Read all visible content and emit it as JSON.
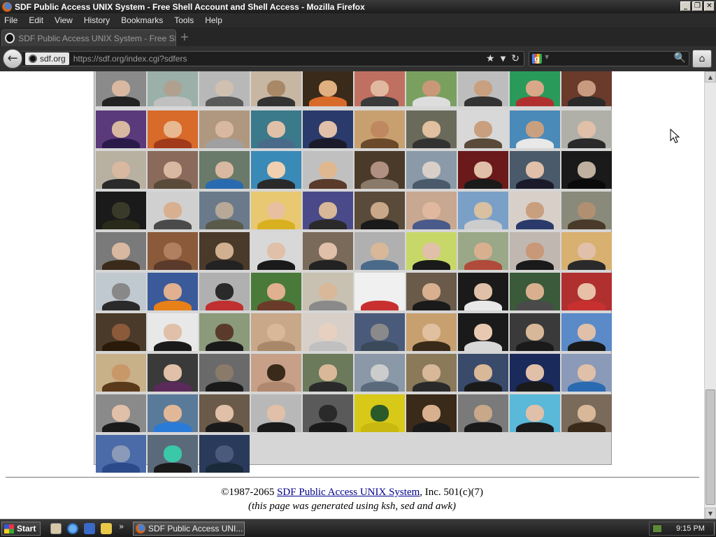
{
  "window": {
    "title": "SDF Public Access UNIX System - Free Shell Account and Shell Access - Mozilla Firefox",
    "controls": {
      "minimize": "_",
      "maximize": "❐",
      "close": "✕"
    }
  },
  "menu": [
    "File",
    "Edit",
    "View",
    "History",
    "Bookmarks",
    "Tools",
    "Help"
  ],
  "tab": {
    "label": "SDF Public Access UNIX System - Free Shell",
    "new_tab": "+"
  },
  "nav": {
    "back": "←",
    "site_chip": "sdf.org",
    "url": "https://sdf.org/index.cgi?sdfers",
    "icons": {
      "star": "★",
      "dropdown": "▼",
      "reload": "↻"
    },
    "search": {
      "engine": "g",
      "dropdown": "▼",
      "go": "🔍"
    },
    "home": "⌂"
  },
  "gallery": {
    "rows": [
      [
        [
          "#8a8a8a",
          "#222",
          "#d8b8a0"
        ],
        [
          "#9ab0a8",
          "#c0c0c0",
          "#b0a090"
        ],
        [
          "#b8b8b8",
          "#5a5a5a",
          "#d0c0b0"
        ],
        [
          "#c6b6a2",
          "#333",
          "#a88866"
        ],
        [
          "#3a2a1a",
          "#d86a2a",
          "#e0b080"
        ],
        [
          "#c07060",
          "#3a3a3a",
          "#e0b8a0"
        ],
        [
          "#7aa060",
          "#ddd",
          "#c89878"
        ],
        [
          "#bdbdbd",
          "#333",
          "#c8a080"
        ],
        [
          "#2a9a5a",
          "#b03030",
          "#d8a888"
        ],
        [
          "#6a3a2a",
          "#2a2a2a",
          "#c89a80"
        ]
      ],
      [
        [
          "#5a3a7a",
          "#2a1a4a",
          "#d8b8a0"
        ],
        [
          "#d86a2a",
          "#a03a1a",
          "#e8b890"
        ],
        [
          "#b09880",
          "#a0a0a0",
          "#d8b8a0"
        ],
        [
          "#3a7a8a",
          "#4a6a8a",
          "#e0c0a8"
        ],
        [
          "#2a3a6a",
          "#1a1a2a",
          "#e0c0a8"
        ],
        [
          "#c8a070",
          "#6a4a2a",
          "#c08860"
        ],
        [
          "#6a6a5a",
          "#333",
          "#e0c0a0"
        ],
        [
          "#d8d8d8",
          "#5a4a3a",
          "#c8a080"
        ],
        [
          "#4a8ab8",
          "#e8e8e8",
          "#c8a080"
        ],
        [
          "#b0b0a8",
          "#2a2a2a",
          "#e0c0a8"
        ]
      ],
      [
        [
          "#b8b0a0",
          "#2a2a2a",
          "#d8b8a0"
        ],
        [
          "#8a6a5a",
          "#5a4a3a",
          "#d8b8a0"
        ],
        [
          "#6a7a6a",
          "#2a6ab0",
          "#d8b8a0"
        ],
        [
          "#3a8ab8",
          "#2a2a2a",
          "#f0d0b0"
        ],
        [
          "#c0c0c0",
          "#5a3a2a",
          "#e0b890"
        ],
        [
          "#4a3a2a",
          "#8a7a6a",
          "#b09080"
        ],
        [
          "#8a9aa8",
          "#4a5a6a",
          "#d8d0c8"
        ],
        [
          "#6a1a1a",
          "#1a1a1a",
          "#e0c0a8"
        ],
        [
          "#4a5a6a",
          "#1a1a2a",
          "#e0c0a8"
        ],
        [
          "#1a1a1a",
          "#0a0a0a",
          "#c0b0a0"
        ]
      ],
      [
        [
          "#1a1a1a",
          "#2a2a1a",
          "#3a3a2a"
        ],
        [
          "#d0d0d0",
          "#4a4a4a",
          "#d8b090"
        ],
        [
          "#6a7a8a",
          "#5a5a4a",
          "#b8a898"
        ],
        [
          "#e8c870",
          "#d8b020",
          "#e8c0a0"
        ],
        [
          "#4a4a8a",
          "#2a2a2a",
          "#d8b898"
        ],
        [
          "#5a4a3a",
          "#1a1a1a",
          "#c8a888"
        ],
        [
          "#c8a890",
          "#4a5a8a",
          "#e0b8a0"
        ],
        [
          "#7aa0c8",
          "#ccc",
          "#d8c0a0"
        ],
        [
          "#d8d0c8",
          "#2a3a6a",
          "#c8a080"
        ],
        [
          "#8a8a7a",
          "#4a3a2a",
          "#b09070"
        ]
      ],
      [
        [
          "#7a7a7a",
          "#3a2a1a",
          "#d8b8a0"
        ],
        [
          "#8a5a3a",
          "#5a3a2a",
          "#b08060"
        ],
        [
          "#4a3a2a",
          "#222",
          "#d0b090"
        ],
        [
          "#d8d8d8",
          "#1a1a1a",
          "#e0c0a8"
        ],
        [
          "#7a6a5a",
          "#222",
          "#e0c0a8"
        ],
        [
          "#b0b0b0",
          "#4a6a8a",
          "#d8b898"
        ],
        [
          "#c8d868",
          "#1a1a1a",
          "#e0c0a8"
        ],
        [
          "#9aa888",
          "#b04a3a",
          "#d8b090"
        ],
        [
          "#c0b8b0",
          "#1a1a1a",
          "#c89878"
        ],
        [
          "#d8b070",
          "#2a2a2a",
          "#e0c0a8"
        ]
      ],
      [
        [
          "#c0c8d0",
          "#2a2a2a",
          "#888888"
        ],
        [
          "#3a5a9a",
          "#e8801a",
          "#e0b090"
        ],
        [
          "#b0b0b0",
          "#c03030",
          "#2a2a2a"
        ],
        [
          "#4a7a3a",
          "#6a3a2a",
          "#e0b090"
        ],
        [
          "#c8c0b0",
          "#8a8a8a",
          "#d8b898"
        ],
        [
          "#f0f0f0",
          "#c83030",
          "#f0f0f0"
        ],
        [
          "#6a5a4a",
          "#1a1a1a",
          "#d8b090"
        ],
        [
          "#1a1a1a",
          "#e8e8e8",
          "#e0c0a8"
        ],
        [
          "#3a5a3a",
          "#4a4a4a",
          "#d8b090"
        ],
        [
          "#b03030",
          "#c83030",
          "#e8c0a8"
        ]
      ],
      [
        [
          "#4a3a2a",
          "#2a1a0a",
          "#8a5a3a"
        ],
        [
          "#e8e8e8",
          "#1a1a1a",
          "#e0c0a8"
        ],
        [
          "#8a9a7a",
          "#1a1a1a",
          "#5a3a2a"
        ],
        [
          "#c8a888",
          "#a88868",
          "#d8b898"
        ],
        [
          "#d8d0c8",
          "#c0c0c0",
          "#e8d0c0"
        ],
        [
          "#4a5a7a",
          "#3a4a5a",
          "#8a8a8a"
        ],
        [
          "#c8a070",
          "#3a2a1a",
          "#e0c0a0"
        ],
        [
          "#1a1a1a",
          "#d8d8d8",
          "#e8c8b0"
        ],
        [
          "#3a3a3a",
          "#1a1a1a",
          "#d8b898"
        ],
        [
          "#5a8ac8",
          "#1a1a1a",
          "#e0c0a8"
        ]
      ],
      [
        [
          "#c8b088",
          "#5a3a1a",
          "#c89868"
        ],
        [
          "#3a3a3a",
          "#5a2a5a",
          "#e0c0a8"
        ],
        [
          "#6a6a6a",
          "#1a1a1a",
          "#8a7a6a"
        ],
        [
          "#c8a088",
          "#b08870",
          "#3a2a1a"
        ],
        [
          "#6a7a5a",
          "#2a2a2a",
          "#d8b898"
        ],
        [
          "#8a98a8",
          "#5a6a7a",
          "#ccc"
        ],
        [
          "#8a7a5a",
          "#2a2a2a",
          "#d8b898"
        ],
        [
          "#3a4a6a",
          "#1a1a1a",
          "#d8b898"
        ],
        [
          "#1a2a5a",
          "#1a1a1a",
          "#e0c0a8"
        ],
        [
          "#8a9ab8",
          "#2a6ab0",
          "#e0c0a8"
        ]
      ],
      [
        [
          "#8a8a8a",
          "#1a1a1a",
          "#e0c0a8"
        ],
        [
          "#5a7a9a",
          "#2a7ad8",
          "#e0b898"
        ],
        [
          "#6a5a4a",
          "#1a1a1a",
          "#e0c0a8"
        ],
        [
          "#b8b8b8",
          "#1a1a1a",
          "#e0c0a8"
        ],
        [
          "#5a5a5a",
          "#1a1a1a",
          "#2a2a2a"
        ],
        [
          "#d8c818",
          "#c8b810",
          "#2a5a2a"
        ],
        [
          "#3a2a1a",
          "#1a1a1a",
          "#d8b090"
        ],
        [
          "#7a7a7a",
          "#1a1a1a",
          "#c8a888"
        ],
        [
          "#5ab8d8",
          "#1a1a1a",
          "#e0c0a8"
        ],
        [
          "#7a6a5a",
          "#3a2a1a",
          "#d8b898"
        ]
      ],
      [
        [
          "#4a6aa8",
          "#2a4a8a",
          "#8a9ab8"
        ],
        [
          "#5a6a7a",
          "#1a1a1a",
          "#3ac8a8"
        ],
        [
          "#2a3a5a",
          "#1a2a3a",
          "#4a5a7a"
        ]
      ]
    ]
  },
  "footer": {
    "copyright_prefix": "©1987-2065 ",
    "link_text": "SDF Public Access UNIX System",
    "copyright_suffix": ", Inc. 501(c)(7)",
    "note": "(this page was generated using ksh, sed and awk)"
  },
  "taskbar": {
    "start_label": "Start",
    "overflow": "»",
    "task_label": "SDF Public Access UNI...",
    "clock": "9:15 PM"
  }
}
